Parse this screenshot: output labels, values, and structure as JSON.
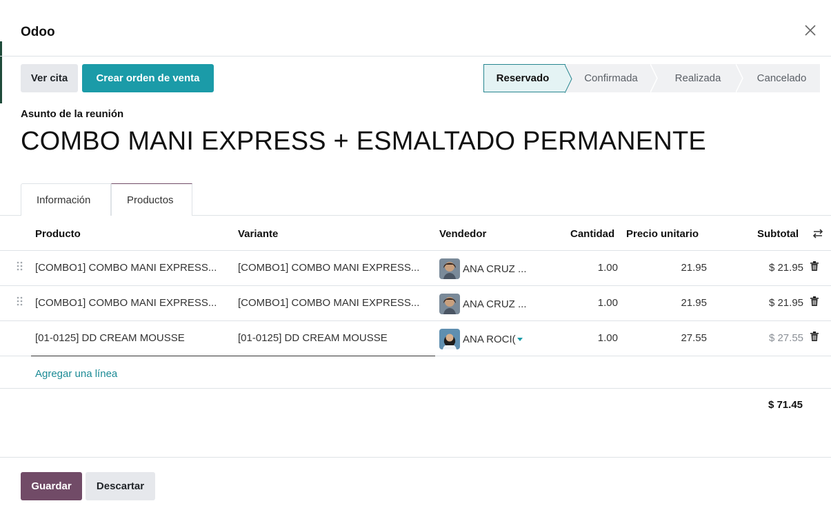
{
  "dialog": {
    "title": "Odoo",
    "close_icon": "close-icon"
  },
  "buttons": {
    "ver_cita": "Ver cita",
    "crear_orden": "Crear orden de venta",
    "guardar": "Guardar",
    "descartar": "Descartar"
  },
  "statusbar": {
    "stages": [
      "Reservado",
      "Confirmada",
      "Realizada",
      "Cancelado"
    ],
    "active": "Reservado"
  },
  "form": {
    "subject_label": "Asunto de la reunión",
    "subject": "COMBO MANI EXPRESS + ESMALTADO PERMANENTE"
  },
  "tabs": [
    "Información",
    "Productos"
  ],
  "active_tab": "Productos",
  "table": {
    "headers": {
      "producto": "Producto",
      "variante": "Variante",
      "vendedor": "Vendedor",
      "cantidad": "Cantidad",
      "precio": "Precio unitario",
      "subtotal": "Subtotal"
    },
    "rows": [
      {
        "producto": "[COMBO1] COMBO MANI EXPRESS...",
        "variante": "[COMBO1] COMBO MANI EXPRESS...",
        "vendedor": "ANA CRUZ ...",
        "cantidad": "1.00",
        "precio": "21.95",
        "subtotal": "$ 21.95"
      },
      {
        "producto": "[COMBO1] COMBO MANI EXPRESS...",
        "variante": "[COMBO1] COMBO MANI EXPRESS...",
        "vendedor": "ANA CRUZ ...",
        "cantidad": "1.00",
        "precio": "21.95",
        "subtotal": "$ 21.95"
      },
      {
        "producto": "[01-0125] DD CREAM MOUSSE",
        "variante": "[01-0125] DD CREAM MOUSSE",
        "vendedor": "ANA ROCI(",
        "cantidad": "1.00",
        "precio": "27.55",
        "subtotal": "$ 27.55"
      }
    ],
    "add_line": "Agregar una línea",
    "total": "$ 71.45"
  },
  "colors": {
    "primary": "#714b67",
    "accent": "#1b9ba8",
    "border": "#dee2e6"
  }
}
